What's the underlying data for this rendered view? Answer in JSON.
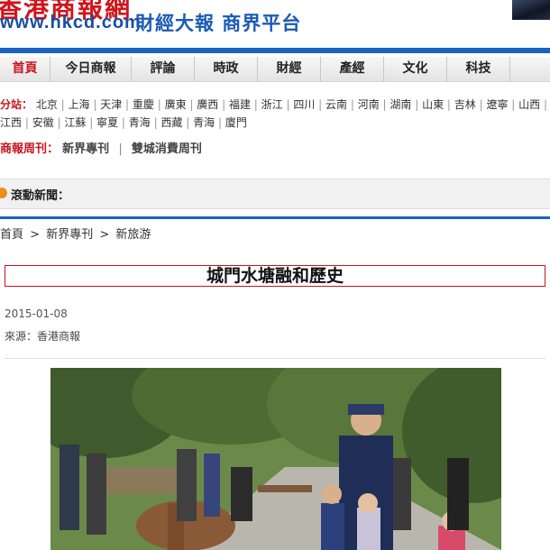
{
  "header": {
    "logo_chinese": "香港商報網",
    "logo_url": "www.hkcd.com",
    "slogan": "財經大報 商界平台"
  },
  "nav": {
    "items": [
      {
        "label": "首頁"
      },
      {
        "label": "今日商報"
      },
      {
        "label": "評論"
      },
      {
        "label": "時政"
      },
      {
        "label": "財經"
      },
      {
        "label": "產經"
      },
      {
        "label": "文化"
      },
      {
        "label": "科技"
      }
    ]
  },
  "regions": {
    "label": "分站：",
    "items": [
      "北京",
      "上海",
      "天津",
      "重慶",
      "廣東",
      "廣西",
      "福建",
      "浙江",
      "四川",
      "云南",
      "河南",
      "湖南",
      "山東",
      "吉林",
      "遼寧",
      "山西",
      "江西",
      "安徽",
      "江蘇",
      "寧夏",
      "青海",
      "西藏",
      "青海",
      "廈門"
    ]
  },
  "weekly": {
    "label": "商報周刊：",
    "links": [
      "新界專刊",
      "雙城消費周刊"
    ],
    "separator": "|"
  },
  "scroll_news": {
    "label": "滾動新聞："
  },
  "breadcrumb": {
    "items": [
      "首頁",
      "新界專刊",
      "新旅游"
    ],
    "separator": ">"
  },
  "article": {
    "title": "城門水塘融和歷史",
    "date": "2015-01-08",
    "source": "來源：香港商報"
  },
  "colors": {
    "brand_red": "#c8141c",
    "brand_blue": "#1b62c2"
  }
}
